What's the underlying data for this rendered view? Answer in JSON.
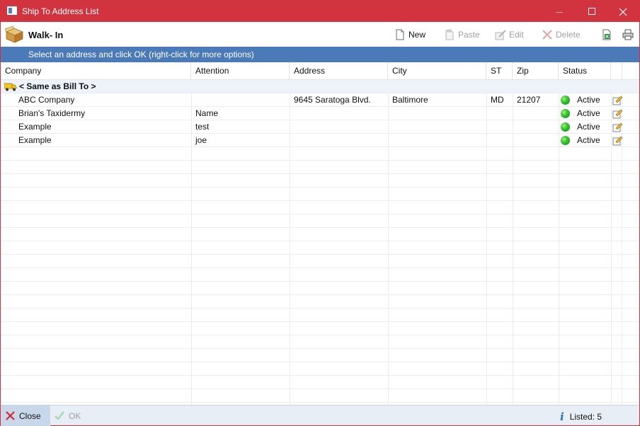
{
  "window": {
    "title": "Ship To Address List"
  },
  "header": {
    "customer": "Walk- In"
  },
  "toolbar": {
    "new_label": "New",
    "paste_label": "Paste",
    "edit_label": "Edit",
    "delete_label": "Delete"
  },
  "info_bar": {
    "text": "Select an address and click OK   (right-click for more options)"
  },
  "grid": {
    "columns": [
      "Company",
      "Attention",
      "Address",
      "City",
      "ST",
      "Zip",
      "Status"
    ],
    "group_row": {
      "label": "< Same as Bill To >"
    },
    "rows": [
      {
        "company": "ABC Company",
        "attention": "",
        "address": "9645 Saratoga Blvd.",
        "city": "Baltimore",
        "st": "MD",
        "zip": "21207",
        "status": "Active"
      },
      {
        "company": "Brian's Taxidermy",
        "attention": "Name",
        "address": "",
        "city": "",
        "st": "",
        "zip": "",
        "status": "Active"
      },
      {
        "company": "Example",
        "attention": "test",
        "address": "",
        "city": "",
        "st": "",
        "zip": "",
        "status": "Active"
      },
      {
        "company": "Example",
        "attention": "joe",
        "address": "",
        "city": "",
        "st": "",
        "zip": "",
        "status": "Active"
      }
    ]
  },
  "footer": {
    "close_label": "Close",
    "ok_label": "OK",
    "listed_text": "Listed: 5"
  },
  "colors": {
    "title_bar": "#d1343f",
    "info_bar": "#4a7ab7",
    "status_active": "#2fbf2a"
  }
}
